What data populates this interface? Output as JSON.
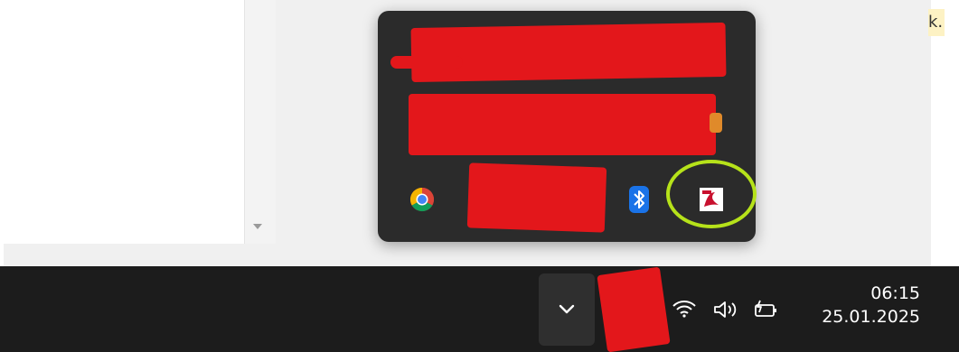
{
  "corner_text": "k.",
  "flyout": {
    "icons": [
      {
        "name": "chrome-icon"
      },
      {
        "name": "bluetooth-icon"
      },
      {
        "name": "pdf-app-icon"
      }
    ]
  },
  "taskbar": {
    "overflow_button_icon": "chevron-down-icon",
    "tray_icons": [
      "wifi-icon",
      "volume-icon",
      "battery-charging-icon"
    ],
    "clock": {
      "time": "06:15",
      "date": "25.01.2025"
    }
  },
  "colors": {
    "redaction": "#e3171b",
    "highlight": "#b6e21a",
    "flyout_bg": "#2b2b2b",
    "taskbar_bg": "#1c1c1c"
  }
}
